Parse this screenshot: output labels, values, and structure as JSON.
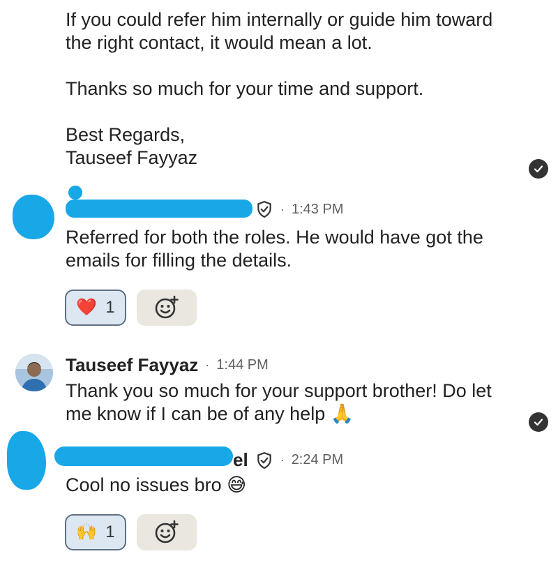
{
  "conversation": {
    "message_1": {
      "text": "If you could refer him internally or guide him toward\nthe right contact, it would mean a lot.\n\nThanks so much for your time and support.\n\nBest Regards,\nTauseef Fayyaz"
    },
    "message_2": {
      "sender": "",
      "time": "1:43 PM",
      "text": "Referred for both the roles. He would have got the\nemails for filling the details.",
      "reaction": {
        "emoji": "❤️",
        "count": "1"
      }
    },
    "message_3": {
      "sender": "Tauseef Fayyaz",
      "time": "1:44 PM",
      "text": "Thank you so much for your support brother! Do let\nme know if I can be of any help 🙏"
    },
    "message_4": {
      "sender_visible_suffix": "el",
      "time": "2:24 PM",
      "text": "Cool no issues bro 😅",
      "reaction": {
        "emoji": "🙌",
        "count": "1"
      }
    },
    "separator": "·"
  },
  "icons": {
    "seen": "seen-check-icon",
    "verified": "shield-check-icon",
    "add_reaction": "add-reaction-icon",
    "heart": "heart-emoji",
    "raised_hands": "raised-hands-emoji"
  },
  "colors": {
    "redaction": "#18a8e8",
    "reaction_bg": "#dde7f2",
    "reaction_border": "#5f6f82",
    "add_reaction_bg": "#eae7e0"
  }
}
